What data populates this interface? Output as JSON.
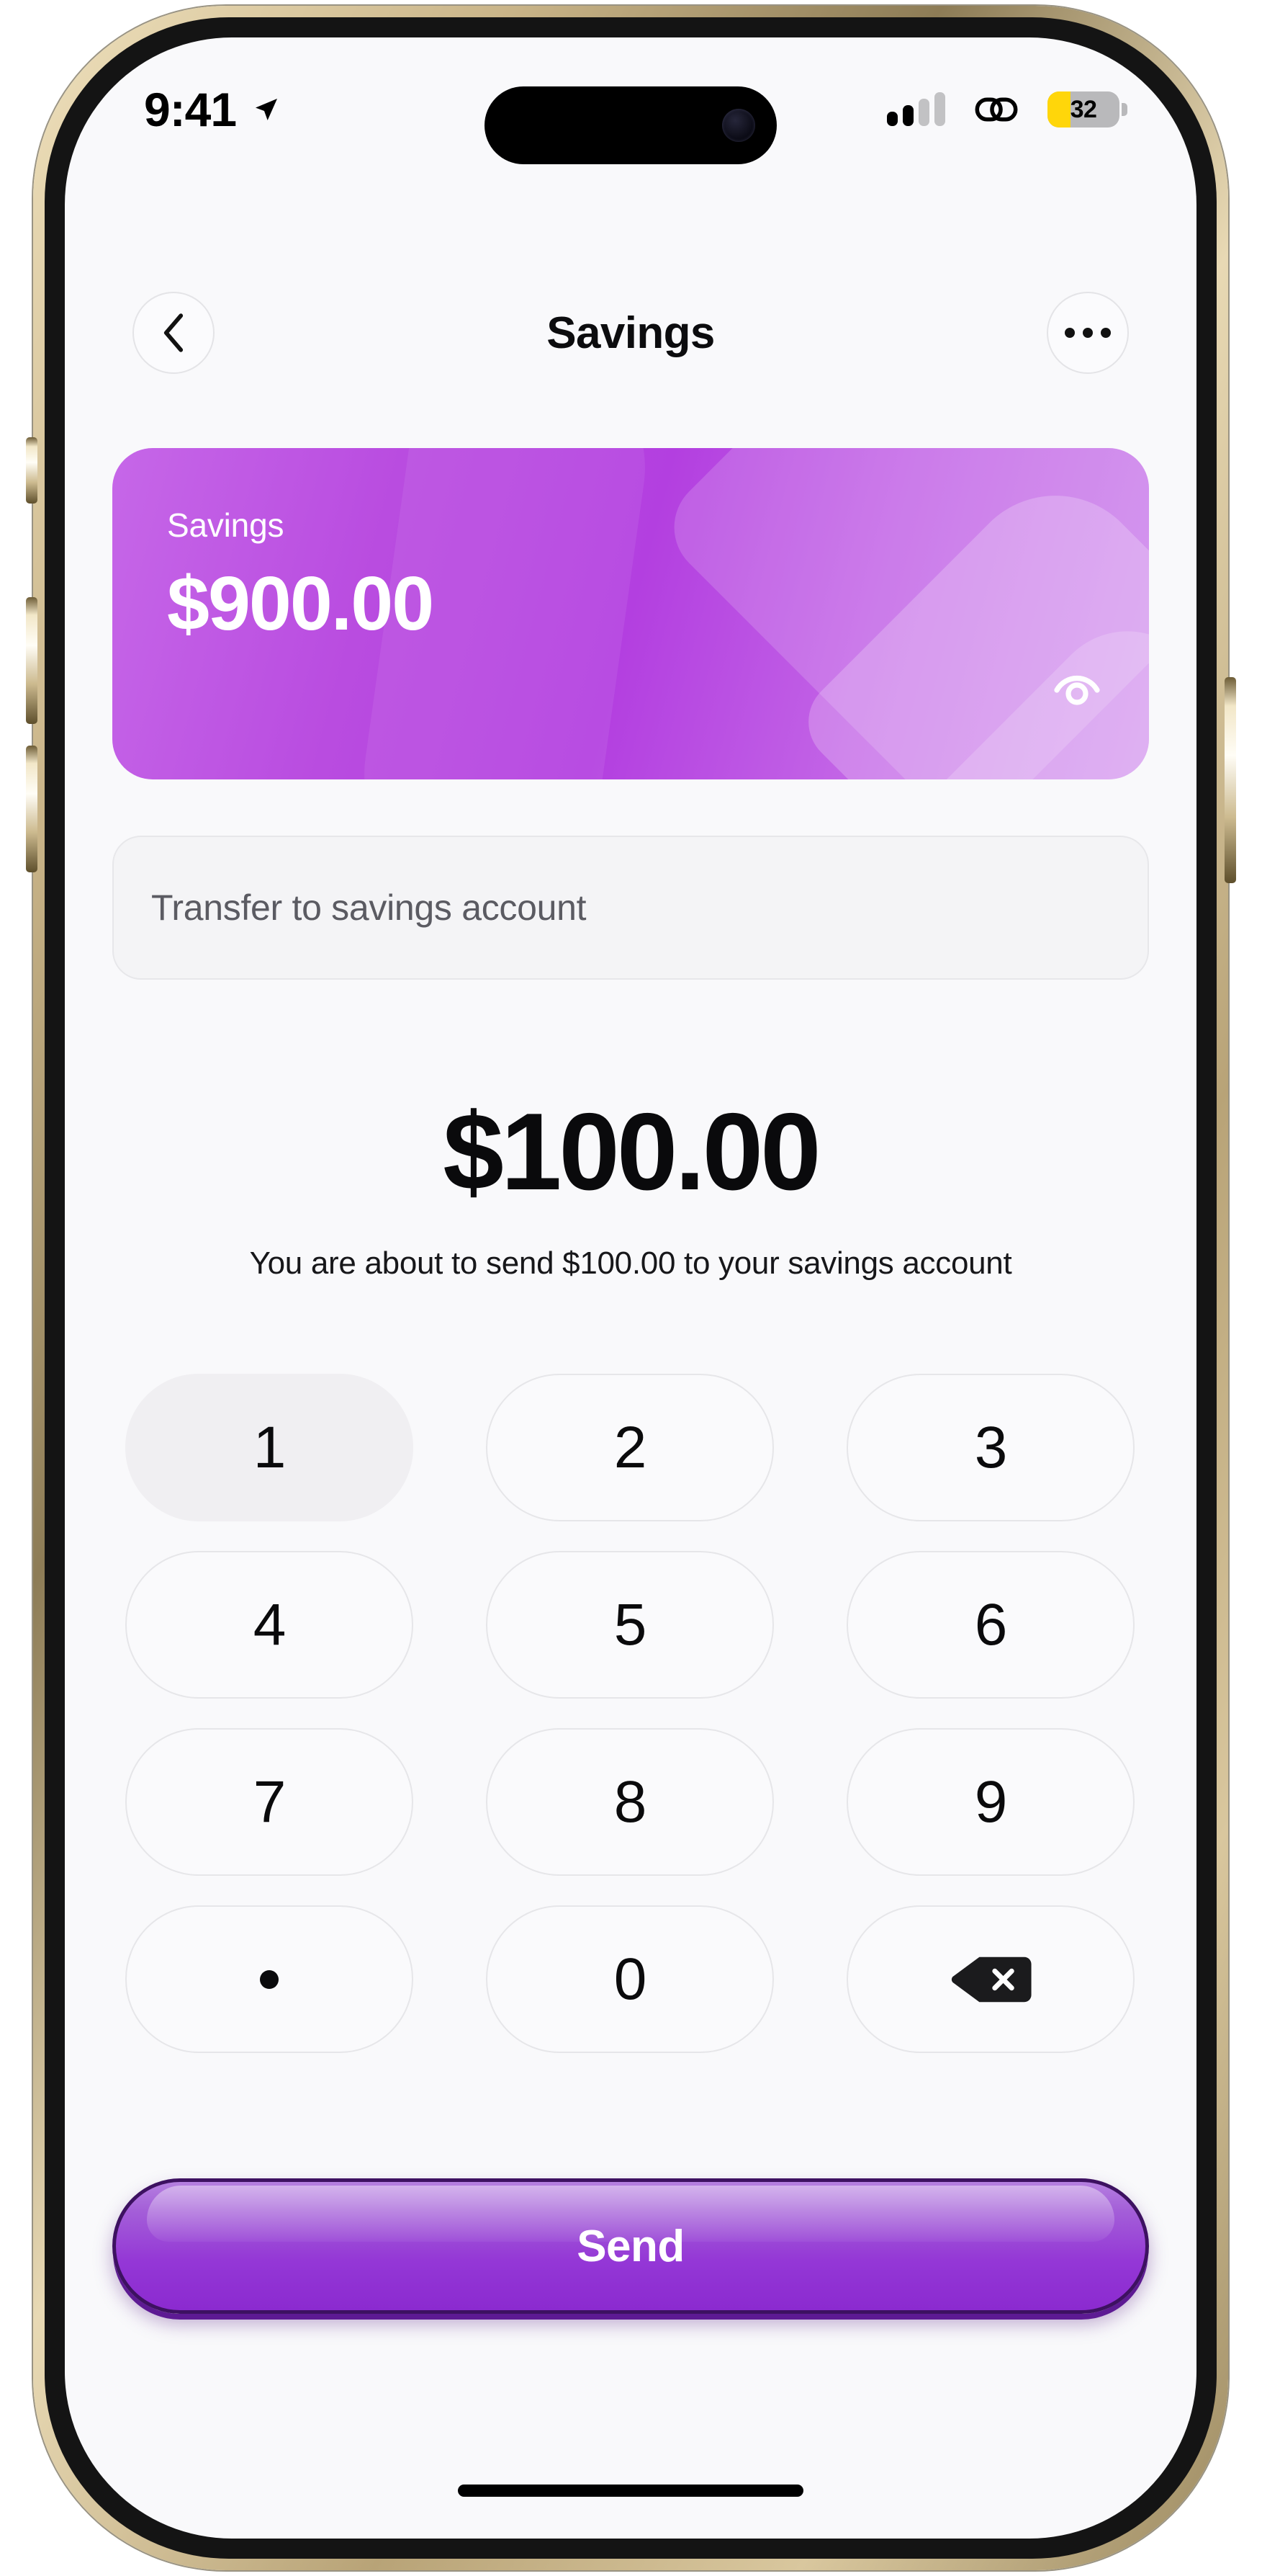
{
  "status_bar": {
    "time": "9:41",
    "location_icon": "location-arrow-icon",
    "signal_icon": "cellular-signal-icon",
    "signal_bars_filled": 2,
    "signal_bars_total": 4,
    "link_icon": "link-chain-icon",
    "battery_percent": "32",
    "battery_color": "#ffd60a",
    "battery_level": 32
  },
  "header": {
    "back_icon": "chevron-left-icon",
    "title": "Savings",
    "more_icon": "more-horizontal-icon"
  },
  "balance_card": {
    "label": "Savings",
    "amount": "$900.00",
    "nfc_icon": "contactless-payment-icon",
    "gradient_from": "#c667e8",
    "gradient_to": "#b33fe0"
  },
  "note": {
    "value": "Transfer to savings account",
    "placeholder": "Transfer to savings account"
  },
  "amount": {
    "value": "$100.00",
    "hint": "You are about to send $100.00 to your savings account"
  },
  "keypad": {
    "keys": [
      {
        "label": "1",
        "name": "key-1",
        "active": true
      },
      {
        "label": "2",
        "name": "key-2",
        "active": false
      },
      {
        "label": "3",
        "name": "key-3",
        "active": false
      },
      {
        "label": "4",
        "name": "key-4",
        "active": false
      },
      {
        "label": "5",
        "name": "key-5",
        "active": false
      },
      {
        "label": "6",
        "name": "key-6",
        "active": false
      },
      {
        "label": "7",
        "name": "key-7",
        "active": false
      },
      {
        "label": "8",
        "name": "key-8",
        "active": false
      },
      {
        "label": "9",
        "name": "key-9",
        "active": false
      },
      {
        "label": ".",
        "name": "key-decimal",
        "active": false
      },
      {
        "label": "0",
        "name": "key-0",
        "active": false
      },
      {
        "label": "",
        "name": "key-backspace",
        "active": false
      }
    ]
  },
  "send_button": {
    "label": "Send",
    "color": "#9437d6"
  }
}
